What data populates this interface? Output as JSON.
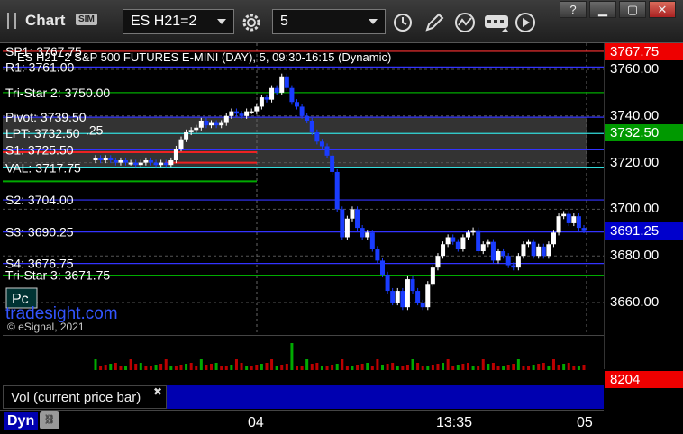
{
  "toolbar": {
    "title": "Chart",
    "sim_badge": "SIM",
    "symbol": "ES H21=2",
    "interval": "5"
  },
  "chart": {
    "header": "ES H21=2 S&P 500 FUTURES E-MINI (DAY), 5, 09:30-16:15 (Dynamic)",
    "levels": [
      {
        "label": "SP1: 3767.75",
        "price": 3767.75,
        "color": "#ff3333"
      },
      {
        "label": "R1: 3761.00",
        "price": 3761.0,
        "color": "#3333ff"
      },
      {
        "label": "Tri-Star 2: 3750.00",
        "price": 3750.0,
        "color": "#00aa00"
      },
      {
        "label": "Pivot: 3739.50",
        "price": 3739.5,
        "color": "#3333ff"
      },
      {
        "label": "LPT: 3732.50",
        "price": 3732.5,
        "color": "#33dddd"
      },
      {
        "label": "S1: 3725.50",
        "price": 3725.5,
        "color": "#3333ff"
      },
      {
        "label": "VAL: 3717.75",
        "price": 3717.75,
        "color": "#33dddd"
      },
      {
        "label": "S2: 3704.00",
        "price": 3704.0,
        "color": "#3333ff"
      },
      {
        "label": "S3: 3690.25",
        "price": 3690.25,
        "color": "#3333ff"
      },
      {
        "label": "S4: 3676.75",
        "price": 3676.75,
        "color": "#3333ff"
      },
      {
        "label": "Tri-Star 3: 3671.75",
        "price": 3671.75,
        "color": "#00aa00"
      }
    ],
    "partial_label": ".25",
    "pc_button": "Pc",
    "watermark": "tradesight.com",
    "copyright": "© eSignal, 2021",
    "price_ticks": [
      "3760.00",
      "3740.00",
      "3720.00",
      "3700.00",
      "3680.00",
      "3660.00"
    ],
    "tag_high": "3767.75",
    "tag_lpt": "3732.50",
    "tag_last": "3691.25",
    "tag_volume": "8204",
    "time_ticks": [
      "04",
      "13:35",
      "05"
    ],
    "volume_label": "Vol (current price bar)",
    "dyn": "Dyn",
    "colors": {
      "up": "#ffffff",
      "down": "#1a3cff",
      "tag_red": "#ee0000",
      "tag_green": "#009900",
      "tag_blue": "#0000cc"
    }
  },
  "chart_data": {
    "type": "candlestick",
    "symbol": "ES H21=2",
    "interval": "5",
    "ylim": [
      3650,
      3775
    ],
    "closes": [
      3722,
      3721,
      3722,
      3721,
      3720,
      3721,
      3720,
      3720,
      3719,
      3720,
      3721,
      3720,
      3719,
      3720,
      3719,
      3721,
      3726,
      3730,
      3733,
      3734,
      3735,
      3738,
      3736,
      3737,
      3736,
      3737,
      3740,
      3742,
      3741,
      3740,
      3742,
      3742,
      3744,
      3748,
      3747,
      3752,
      3750,
      3757,
      3752,
      3746,
      3744,
      3740,
      3738,
      3733,
      3729,
      3727,
      3723,
      3716,
      3700,
      3688,
      3696,
      3700,
      3692,
      3688,
      3690,
      3683,
      3678,
      3672,
      3665,
      3660,
      3665,
      3658,
      3670,
      3665,
      3660,
      3658,
      3668,
      3675,
      3680,
      3685,
      3688,
      3686,
      3683,
      3688,
      3690,
      3691,
      3682,
      3685,
      3686,
      3678,
      3682,
      3680,
      3676,
      3675,
      3680,
      3685,
      3686,
      3680,
      3684,
      3680,
      3685,
      3690,
      3697,
      3698,
      3694,
      3697,
      3692,
      3691
    ],
    "volume_last": 8204
  }
}
